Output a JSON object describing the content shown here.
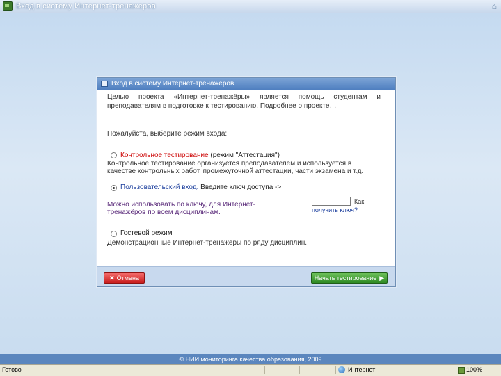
{
  "window": {
    "title": "Вход в систему Интернет-тренажеров"
  },
  "dialog": {
    "title": "Вход в систему Интернет-тренажеров",
    "intro": "Целью проекта «Интернет-тренажёры» является помощь студентам и преподавателям в подготовке к тестированию. Подробнее о проекте…",
    "prompt": "Пожалуйста, выберите режим входа:",
    "options": [
      {
        "title": "Контрольное тестирование",
        "suffix": "(режим \"Аттестация\")",
        "description": "Контрольное тестирование организуется преподавателем и используется в качестве контрольных работ, промежуточной аттестации, части экзамена и т.д.",
        "selected": false
      },
      {
        "title": "Пользовательский вход.",
        "suffix": "Введите ключ доступа ->",
        "description": "Можно использовать по ключу, для Интернет-тренажёров по всем дисциплинам.",
        "selected": true
      },
      {
        "title": "Гостевой режим",
        "suffix": "",
        "description": "Демонстрационные Интернет-тренажёры по ряду дисциплин.",
        "selected": false
      }
    ],
    "key_field": {
      "value": "",
      "placeholder": ""
    },
    "how_to_get_text": "Как",
    "how_to_get_link": "получить ключ?",
    "cancel_label": "Отмена",
    "start_label": "Начать тестирование"
  },
  "footer": {
    "copyright": "© НИИ мониторинга качества образования, 2009"
  },
  "statusbar": {
    "left": "Готово",
    "zone": "Интернет",
    "zoom": "100%"
  },
  "icons": {
    "window": "app-icon",
    "dialog": "window-square-icon",
    "cancel": "close-icon",
    "start": "arrow-right-icon",
    "zone": "globe-icon",
    "security": "lock-icon"
  },
  "colors": {
    "accent": "#4f7fc0",
    "cancel": "#c81e1e",
    "start": "#2f8a24",
    "highlight": "#cc0000"
  }
}
